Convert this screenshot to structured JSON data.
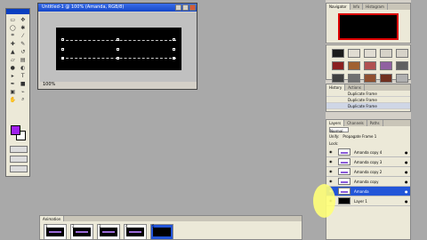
{
  "document": {
    "title": "Untitled-1 @ 100% (Amanda, RGB/8)",
    "zoom": "100%"
  },
  "panels": {
    "navigator": {
      "tabs": [
        "Navigator",
        "Info",
        "Histogram"
      ]
    },
    "swatches_top_colors": [
      "#1b1b1b",
      "#e0dcd2",
      "#e0dcd2",
      "#d6d2c8",
      "#d6d2c8"
    ],
    "swatches_colors": [
      "#8b2020",
      "#a06030",
      "#b05050",
      "#9060a0",
      "#606060",
      "#404040",
      "#707070",
      "#905030",
      "#703020",
      "#b0b0b0"
    ],
    "history": {
      "tabs": [
        "History",
        "Actions"
      ],
      "rows": [
        "Duplicate Frame",
        "Duplicate Frame",
        "Duplicate Frame"
      ]
    },
    "layers": {
      "tabs": [
        "Layers",
        "Channels",
        "Paths"
      ],
      "blend_mode": "Normal",
      "unify_label": "Unify:",
      "lock_label": "Lock:",
      "propagate_label": "Propagate Frame 1",
      "rows": [
        {
          "name": "Amanda copy 4",
          "selected": false,
          "thumb": "purple-text"
        },
        {
          "name": "Amanda copy 3",
          "selected": false,
          "thumb": "purple-text"
        },
        {
          "name": "Amanda copy 2",
          "selected": false,
          "thumb": "purple-text"
        },
        {
          "name": "Amanda copy",
          "selected": false,
          "thumb": "purple-text"
        },
        {
          "name": "Amanda",
          "selected": true,
          "thumb": "purple-text"
        },
        {
          "name": "Layer 1",
          "selected": false,
          "thumb": "black"
        }
      ]
    }
  },
  "animation": {
    "tab": "Animation",
    "frames": [
      {
        "num": "1"
      },
      {
        "num": "2"
      },
      {
        "num": "3"
      },
      {
        "num": "4"
      },
      {
        "num": "5"
      }
    ]
  },
  "colors": {
    "foreground": "#a020f0",
    "background": "#ffffff",
    "selection": "#2255d8"
  }
}
